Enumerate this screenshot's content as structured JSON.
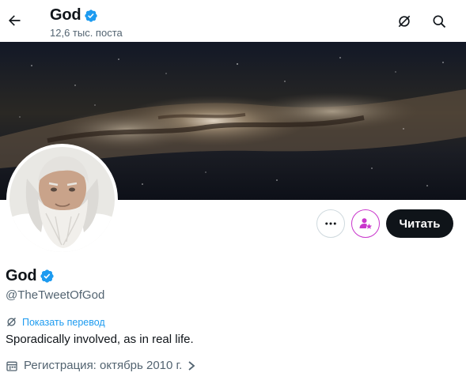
{
  "header": {
    "name": "God",
    "posts_count": "12,6 тыс. поста"
  },
  "profile": {
    "follow_label": "Читать",
    "display_name": "God",
    "handle": "@TheTweetOfGod",
    "translate_label": "Показать перевод",
    "bio": "Sporadically involved, as in real life.",
    "joined": "Регистрация: октябрь 2010 г."
  },
  "icons": {
    "back": "arrow-left-icon",
    "translate": "translate-icon",
    "search": "search-icon",
    "verified": "verified-badge-icon",
    "more": "more-dots-icon",
    "subscribe": "subscribe-star-icon",
    "calendar": "calendar-icon",
    "chevron": "chevron-right-icon"
  },
  "colors": {
    "verified": "#1d9bf0",
    "link": "#1d9bf0",
    "follow_button": "#0f1419",
    "subscribe_accent": "#c936cc",
    "secondary_text": "#536471"
  }
}
